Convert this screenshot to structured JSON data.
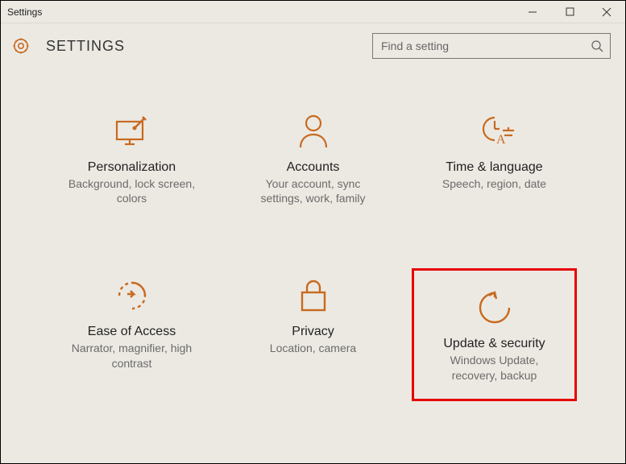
{
  "window": {
    "title": "Settings"
  },
  "header": {
    "app_title": "SETTINGS"
  },
  "search": {
    "placeholder": "Find a setting",
    "value": ""
  },
  "accent_color": "#c86a20",
  "tiles": [
    {
      "icon": "personalization-icon",
      "title": "Personalization",
      "desc": "Background, lock screen, colors",
      "highlighted": false
    },
    {
      "icon": "accounts-icon",
      "title": "Accounts",
      "desc": "Your account, sync settings, work, family",
      "highlighted": false
    },
    {
      "icon": "time-language-icon",
      "title": "Time & language",
      "desc": "Speech, region, date",
      "highlighted": false
    },
    {
      "icon": "ease-of-access-icon",
      "title": "Ease of Access",
      "desc": "Narrator, magnifier, high contrast",
      "highlighted": false
    },
    {
      "icon": "privacy-icon",
      "title": "Privacy",
      "desc": "Location, camera",
      "highlighted": false
    },
    {
      "icon": "update-security-icon",
      "title": "Update & security",
      "desc": "Windows Update, recovery, backup",
      "highlighted": true
    }
  ]
}
